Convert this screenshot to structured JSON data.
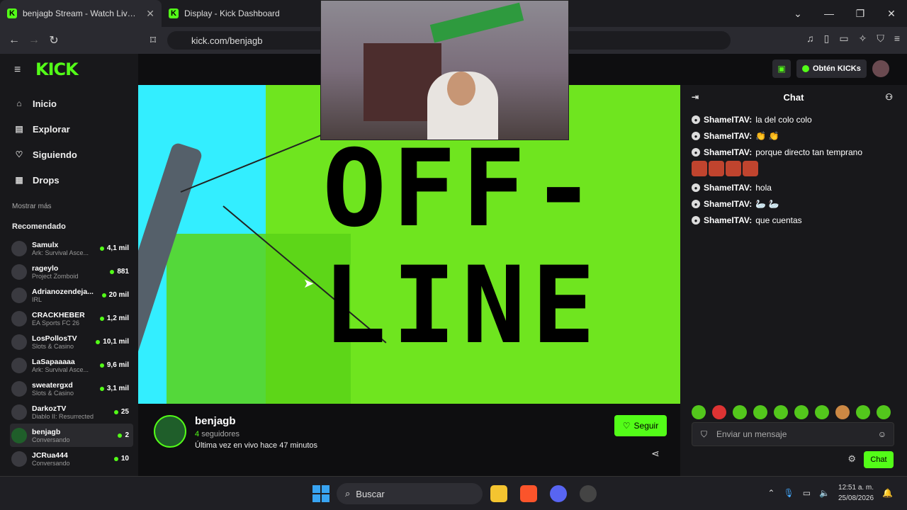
{
  "browser": {
    "tabs": [
      {
        "title": "benjagb Stream - Watch Live on Kick",
        "active": true
      },
      {
        "title": "Display - Kick Dashboard",
        "active": false
      }
    ],
    "url": "kick.com/benjagb"
  },
  "header": {
    "logo": "KICK",
    "kicks_button": "Obtén KICKs"
  },
  "sidebar": {
    "menu": [
      {
        "label": "Inicio",
        "icon": "home-icon"
      },
      {
        "label": "Explorar",
        "icon": "compass-icon"
      },
      {
        "label": "Siguiendo",
        "icon": "heart-icon"
      },
      {
        "label": "Drops",
        "icon": "gift-icon"
      }
    ],
    "show_more": "Mostrar más",
    "recommended_title": "Recomendado",
    "channels": [
      {
        "name": "Samulx",
        "game": "Ark: Survival Asce...",
        "viewers": "4,1 mil"
      },
      {
        "name": "rageylo",
        "game": "Project Zomboid",
        "viewers": "881"
      },
      {
        "name": "Adrianozendeja...",
        "game": "IRL",
        "viewers": "20 mil"
      },
      {
        "name": "CRACKHEBER",
        "game": "EA Sports FC 26",
        "viewers": "1,2 mil"
      },
      {
        "name": "LosPollosTV",
        "game": "Slots & Casino",
        "viewers": "10,1 mil"
      },
      {
        "name": "LaSapaaaaa",
        "game": "Ark: Survival Asce...",
        "viewers": "9,6 mil"
      },
      {
        "name": "sweatergxd",
        "game": "Slots & Casino",
        "viewers": "3,1 mil"
      },
      {
        "name": "DarkozTV",
        "game": "Diablo II: Resurrected",
        "viewers": "25"
      },
      {
        "name": "benjagb",
        "game": "Conversando",
        "viewers": "2"
      },
      {
        "name": "JCRua444",
        "game": "Conversando",
        "viewers": "10"
      }
    ]
  },
  "player": {
    "offline_text_1": "OFF-",
    "offline_text_2": "LINE"
  },
  "streamer": {
    "name": "benjagb",
    "followers_count": "4",
    "followers_label": "seguidores",
    "last_live": "Última vez en vivo hace 47 minutos",
    "follow_label": "Seguir"
  },
  "chat": {
    "title": "Chat",
    "messages": [
      {
        "user": "ShameITAV:",
        "text": "la del colo colo"
      },
      {
        "user": "ShameITAV:",
        "text": ""
      },
      {
        "user": "ShameITAV:",
        "text": "porque directo tan temprano"
      },
      {
        "user": "ShameITAV:",
        "text": "hola"
      },
      {
        "user": "ShameITAV:",
        "text": ""
      },
      {
        "user": "ShameITAV:",
        "text": "que cuentas"
      }
    ],
    "input_placeholder": "Enviar un mensaje",
    "send_label": "Chat"
  },
  "taskbar": {
    "search": "Buscar",
    "time": "12:51 a. m.",
    "date": "25/08/2026"
  },
  "colors": {
    "accent": "#53fc18",
    "player_bg": "#33eeff"
  }
}
